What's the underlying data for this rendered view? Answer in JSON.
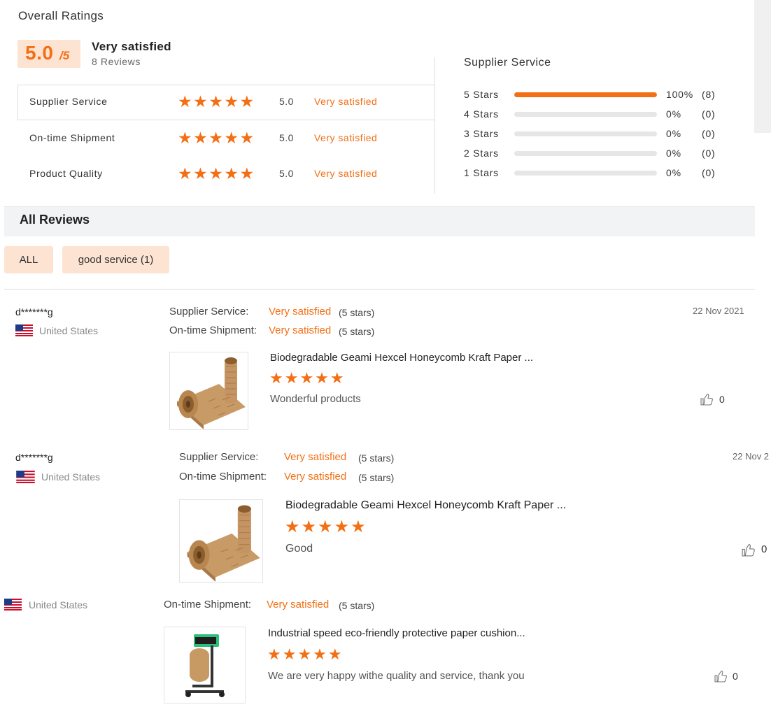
{
  "overall": {
    "title": "Overall Ratings",
    "score": "5.0",
    "score_suffix": "/5",
    "label": "Very satisfied",
    "reviews": "8 Reviews"
  },
  "categories": [
    {
      "name": "Supplier Service",
      "stars": "★★★★★",
      "score": "5.0",
      "label": "Very satisfied"
    },
    {
      "name": "On-time Shipment",
      "stars": "★★★★★",
      "score": "5.0",
      "label": "Very satisfied"
    },
    {
      "name": "Product Quality",
      "stars": "★★★★★",
      "score": "5.0",
      "label": "Very satisfied"
    }
  ],
  "distribution": {
    "title": "Supplier Service",
    "rows": [
      {
        "label": "5 Stars",
        "fraction": 1.0,
        "percent": "100%",
        "count": "(8)"
      },
      {
        "label": "4 Stars",
        "fraction": 0,
        "percent": "0%",
        "count": "(0)"
      },
      {
        "label": "3 Stars",
        "fraction": 0,
        "percent": "0%",
        "count": "(0)"
      },
      {
        "label": "2 Stars",
        "fraction": 0,
        "percent": "0%",
        "count": "(0)"
      },
      {
        "label": "1 Stars",
        "fraction": 0,
        "percent": "0%",
        "count": "(0)"
      }
    ]
  },
  "all_reviews": {
    "title": "All Reviews",
    "filters": [
      "ALL",
      "good service (1)"
    ]
  },
  "reviews": [
    {
      "user": "d*******g",
      "country": "United States",
      "supplier_label": "Supplier Service:",
      "supplier_value": "Very satisfied",
      "supplier_stars": "(5 stars)",
      "shipment_label": "On-time Shipment:",
      "shipment_value": "Very satisfied",
      "shipment_stars": "(5 stars)",
      "date": "22 Nov 2021",
      "product": "Biodegradable Geami Hexcel Honeycomb Kraft Paper ...",
      "stars": "★★★★★",
      "comment": "Wonderful products",
      "likes": "0"
    },
    {
      "user": "d*******g",
      "country": "United States",
      "supplier_label": "Supplier Service:",
      "supplier_value": "Very satisfied",
      "supplier_stars": "(5 stars)",
      "shipment_label": "On-time Shipment:",
      "shipment_value": "Very satisfied",
      "shipment_stars": "(5 stars)",
      "date": "22 Nov 2",
      "product": "Biodegradable Geami Hexcel Honeycomb Kraft Paper ...",
      "stars": "★★★★★",
      "comment": "Good",
      "likes": "0"
    },
    {
      "country": "United States",
      "shipment_label": "On-time Shipment:",
      "shipment_value": "Very satisfied",
      "shipment_stars": "(5 stars)",
      "product": "Industrial speed eco-friendly protective paper cushion...",
      "stars": "★★★★★",
      "comment": "We are very happy withe quality and service, thank you",
      "likes": "0"
    }
  ],
  "colors": {
    "accent": "#f36f15",
    "badge_bg": "#fde3d2",
    "bar_track": "#e6e6e6"
  },
  "icons": [
    "us-flag-icon",
    "thumbs-up-icon",
    "star-icon"
  ]
}
